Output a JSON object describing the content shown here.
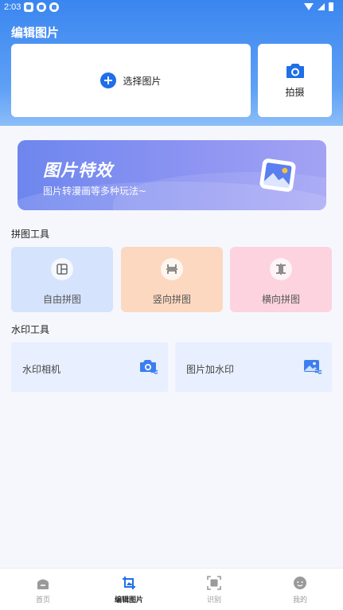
{
  "status_bar": {
    "time": "2:03"
  },
  "page_title": "编辑图片",
  "select_image": {
    "label": "选择图片"
  },
  "shoot": {
    "label": "拍摄"
  },
  "banner": {
    "title": "图片特效",
    "subtitle": "图片转漫画等多种玩法~"
  },
  "collage_section": {
    "title": "拼图工具",
    "tools": [
      {
        "label": "自由拼图",
        "icon": "free-collage-icon",
        "color": "#d5e3fd"
      },
      {
        "label": "竖向拼图",
        "icon": "vertical-collage-icon",
        "color": "#fcd8c0"
      },
      {
        "label": "横向拼图",
        "icon": "horizontal-collage-icon",
        "color": "#fcd3df"
      }
    ]
  },
  "watermark_section": {
    "title": "水印工具",
    "tools": [
      {
        "label": "水印相机",
        "icon": "watermark-camera-icon"
      },
      {
        "label": "图片加水印",
        "icon": "image-watermark-icon"
      }
    ]
  },
  "tabbar": {
    "tabs": [
      {
        "label": "首页",
        "icon": "home-icon",
        "active": false
      },
      {
        "label": "编辑图片",
        "icon": "edit-image-icon",
        "active": true
      },
      {
        "label": "识别",
        "icon": "scan-icon",
        "active": false
      },
      {
        "label": "我的",
        "icon": "profile-icon",
        "active": false
      }
    ]
  },
  "colors": {
    "accent": "#1f6fe8",
    "header": "#3a86f0"
  }
}
